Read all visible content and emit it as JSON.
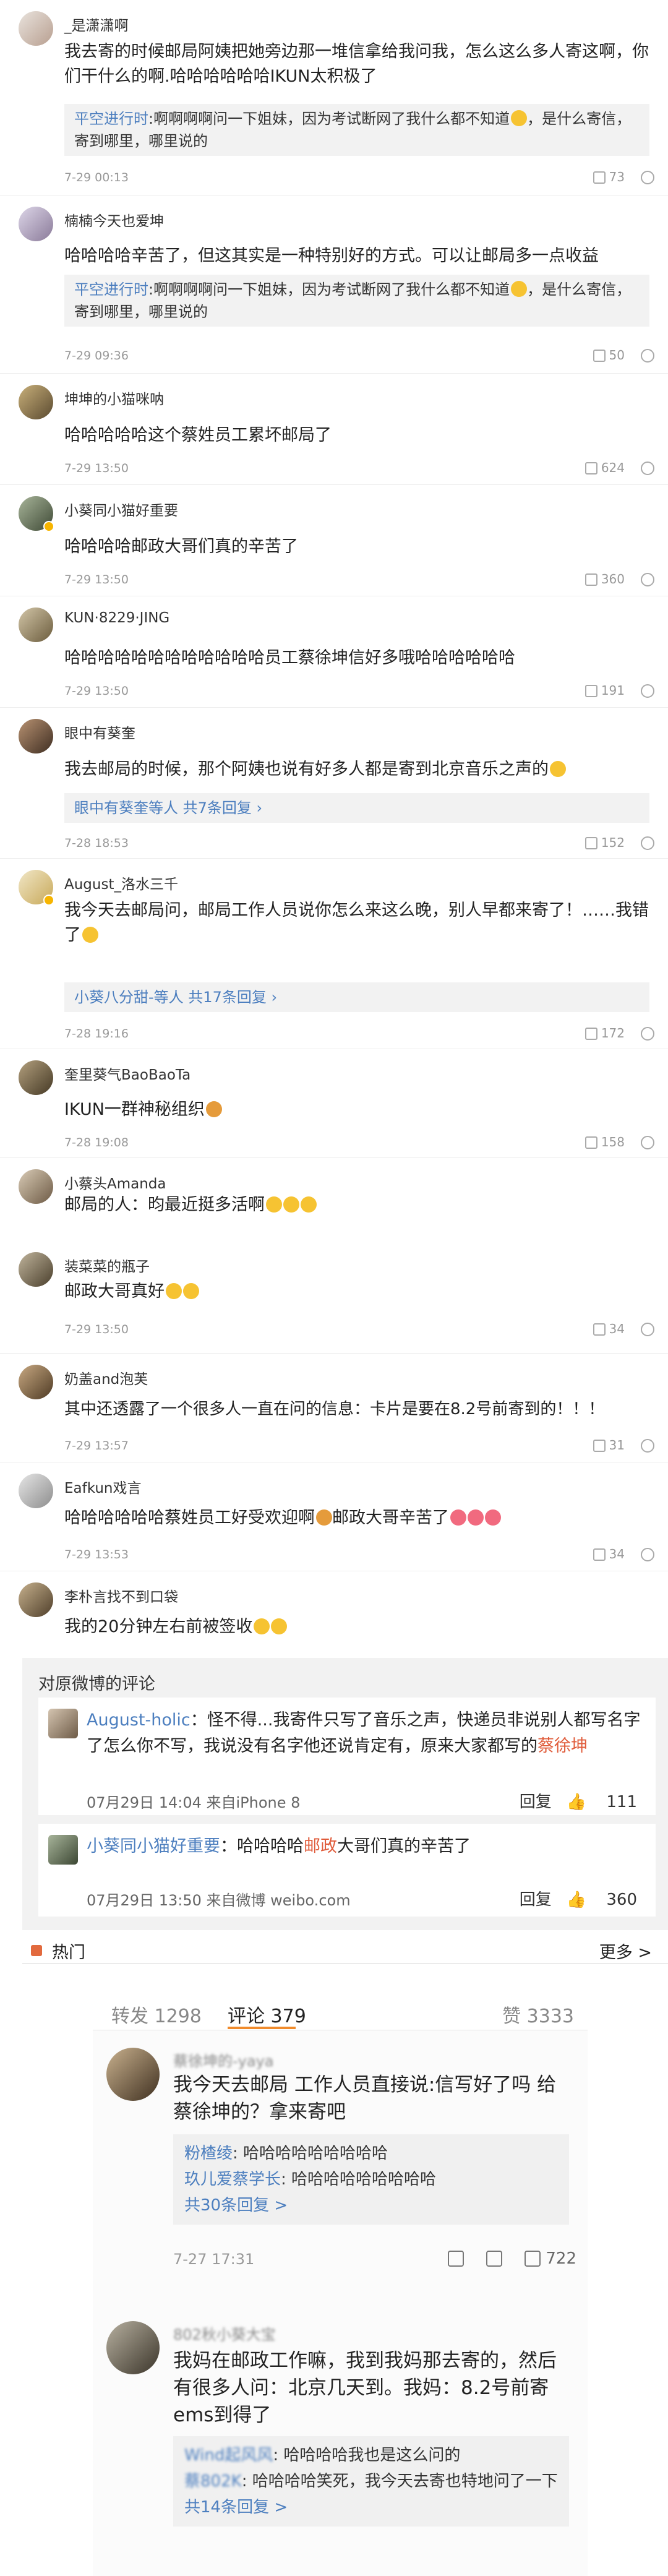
{
  "comments": [
    {
      "name": "_是潇潇啊",
      "text": "我去寄的时候邮局阿姨把她旁边那一堆信拿给我问我，怎么这么多人寄这啊，你们干什么的啊.哈哈哈哈哈哈IKUN太积极了",
      "reply_author": "平空进行时",
      "reply_text": "啊啊啊啊问一下姐妹，因为考试断网了我什么都不知道",
      "reply_text2": "，是什么寄信，寄到哪里，哪里说的",
      "time": "7-29 00:13",
      "likes": "73"
    },
    {
      "name": "楠楠今天也爱坤",
      "text": "哈哈哈哈辛苦了，但这其实是一种特别好的方式。可以让邮局多一点收益",
      "reply_author": "平空进行时",
      "reply_text": "啊啊啊啊问一下姐妹，因为考试断网了我什么都不知道",
      "reply_text2": "，是什么寄信，寄到哪里，哪里说的",
      "time": "7-29 09:36",
      "likes": "50"
    },
    {
      "name": "坤坤的小猫咪呐",
      "text": "哈哈哈哈哈这个蔡姓员工累坏邮局了",
      "time": "7-29 13:50",
      "likes": "624"
    },
    {
      "name": "小葵同小猫好重要",
      "text": "哈哈哈哈邮政大哥们真的辛苦了",
      "time": "7-29 13:50",
      "likes": "360"
    },
    {
      "name": "KUN·8229·JING",
      "text": "哈哈哈哈哈哈哈哈哈哈哈哈员工蔡徐坤信好多哦哈哈哈哈哈哈",
      "time": "7-29 13:50",
      "likes": "191"
    },
    {
      "name": "眼中有葵奎",
      "text": "我去邮局的时候，那个阿姨也说有好多人都是寄到北京音乐之声的",
      "sub_author": "眼中有葵奎",
      "sub_more": "等人 共7条回复",
      "time": "7-28 18:53",
      "likes": "152"
    },
    {
      "name": "August_洛水三千",
      "text": "我今天去邮局问，邮局工作人员说你怎么来这么晚，别人早都来寄了！……我错了",
      "sub_author": "小葵八分甜-",
      "sub_more": "等人 共17条回复",
      "time": "7-28 19:16",
      "likes": "172"
    },
    {
      "name": "奎里葵气BaoBaoTa",
      "text": "IKUN一群神秘组织",
      "time": "7-28 19:08",
      "likes": "158"
    },
    {
      "name": "小蔡头Amanda",
      "text": "邮局的人：昀最近挺多活啊",
      "name2": "装菜菜的瓶子",
      "text2": "邮政大哥真好",
      "time": "7-29 13:50",
      "likes": "34"
    },
    {
      "name": "奶盖and泡芙",
      "text": "其中还透露了一个很多人一直在问的信息：卡片是要在8.2号前寄到的！！！",
      "time": "7-29 13:57",
      "likes": "31"
    },
    {
      "name": "Eafkun戏言",
      "text": "哈哈哈哈哈哈蔡姓员工好受欢迎啊",
      "text_tail": "邮政大哥辛苦了",
      "time": "7-29 13:53",
      "likes": "34"
    },
    {
      "name": "李朴言找不到口袋",
      "text": "我的20分钟左右前被签收"
    }
  ],
  "original": {
    "heading": "对原微博的评论",
    "item1": {
      "author": "August-holic",
      "text": "：怪不得...我寄件只写了音乐之声，快递员非说别人都写名字了怎么你不写，我说没有名字他还说肯定有，原来大家都写的",
      "highlight": "蔡徐坤",
      "meta": "07月29日 14:04 来自iPhone 8",
      "reply": "回复",
      "likes": "111"
    },
    "item2": {
      "author": "小葵同小猫好重要",
      "text": "：哈哈哈哈",
      "highlight": "邮政",
      "text_tail": "大哥们真的辛苦了",
      "meta": "07月29日 13:50 来自微博 weibo.com",
      "reply": "回复",
      "likes": "360"
    }
  },
  "hot": {
    "label": "热门",
    "more": "更多 >"
  },
  "mobile": {
    "tabs": {
      "repost": "转发 1298",
      "comment": "评论 379",
      "like": "赞 3333"
    },
    "c1": {
      "name": "蔡徐坤的-yaya",
      "text": "我今天去邮局 工作人员直接说:信写好了吗 给蔡徐坤的？拿来寄吧",
      "r1_author": "粉楂绫",
      "r1_text": ": 哈哈哈哈哈哈哈哈哈",
      "r2_author": "玖儿爱蔡学长",
      "r2_text": ": 哈哈哈哈哈哈哈哈哈",
      "more": "共30条回复 >",
      "time": "7-27 17:31",
      "likes": "722"
    },
    "c2": {
      "name": "802秋小葵大宝",
      "text": "我妈在邮政工作嘛，我到我妈那去寄的，然后有很多人问：北京几天到。我妈：8.2号前寄ems到得了",
      "r1_author": "Wind起风风",
      "r1_text": ": 哈哈哈哈我也是这么问的",
      "r2_author": "蔡802K",
      "r2_text": ": 哈哈哈哈笑死，我今天去寄也特地问了一下",
      "more": "共14条回复 >"
    }
  }
}
